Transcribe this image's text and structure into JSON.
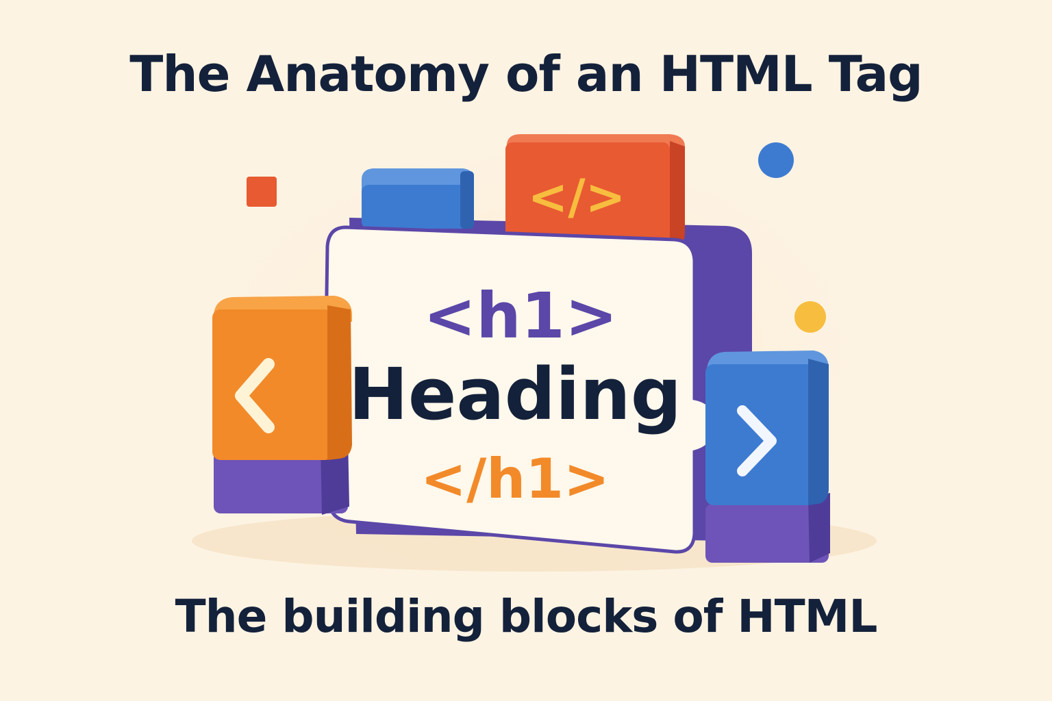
{
  "title": "The Anatomy of an HTML Tag",
  "subtitle": "The building blocks of HTML",
  "card": {
    "open_tag": "<h1>",
    "content": "Heading",
    "close_tag": "</h1>"
  },
  "blocks": {
    "top_red_symbol": "</>",
    "left_symbol": "<",
    "right_symbol": ">"
  },
  "colors": {
    "background": "#fdf3e3",
    "text_dark": "#14213a",
    "purple": "#5b47a8",
    "orange": "#f28a2a",
    "red": "#e85a32",
    "blue": "#3d7bd1",
    "yellow": "#f7bd3f",
    "card": "#fff8ec"
  },
  "icons": {
    "left_block": "chevron-left-icon",
    "right_block": "chevron-right-icon",
    "top_block": "code-icon"
  }
}
